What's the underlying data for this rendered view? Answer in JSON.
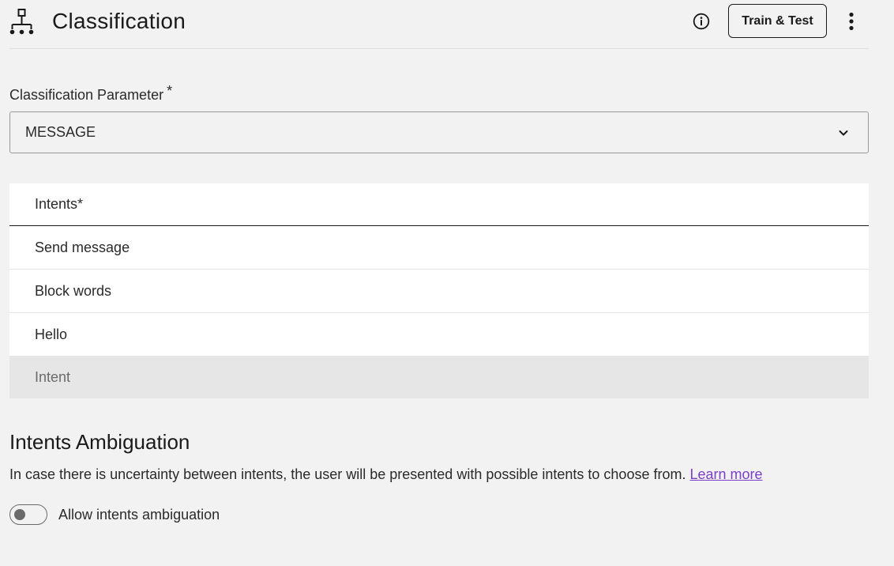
{
  "header": {
    "title": "Classification",
    "icon": "sitemap-icon",
    "train_test_label": "Train & Test",
    "info_icon": "info-icon",
    "more_icon": "more-vertical-icon"
  },
  "classification_parameter": {
    "label": "Classification Parameter",
    "required_mark": "*",
    "value": "MESSAGE",
    "dropdown_icon": "chevron-down-icon"
  },
  "intents": {
    "header": "Intents*",
    "items": [
      "Send message",
      "Block words",
      "Hello"
    ],
    "new_placeholder": "Intent"
  },
  "ambiguation": {
    "title": "Intents Ambiguation",
    "description": "In case there is uncertainty between intents, the user will be presented with possible intents to choose from.",
    "learn_more": "Learn more",
    "toggle_label": "Allow intents ambiguation",
    "toggle_on": false
  },
  "colors": {
    "background": "#f2f2f2",
    "link": "#7b3fc8",
    "text": "#1a1a1a"
  }
}
